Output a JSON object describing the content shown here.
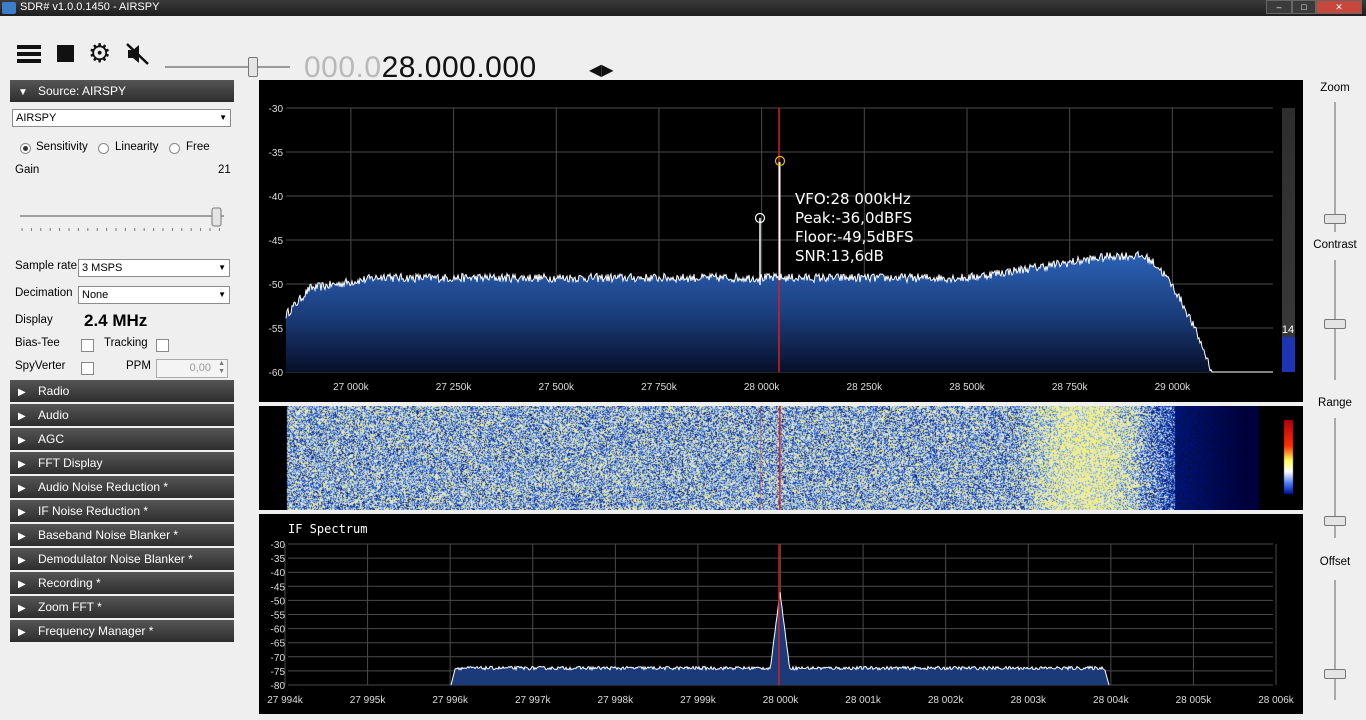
{
  "window": {
    "title": "SDR# v1.0.0.1450 - AIRSPY"
  },
  "toolbar": {
    "freq_dim": "000.0",
    "freq_main": "28.000.000"
  },
  "source": {
    "header": "Source: AIRSPY",
    "device": "AIRSPY",
    "modes": [
      "Sensitivity",
      "Linearity",
      "Free"
    ],
    "selected_mode": "Sensitivity",
    "gain_label": "Gain",
    "gain_value": "21",
    "sample_rate_label": "Sample rate",
    "sample_rate": "3 MSPS",
    "decimation_label": "Decimation",
    "decimation": "None",
    "display_label": "Display",
    "display_value": "2.4 MHz",
    "bias_tee_label": "Bias-Tee",
    "tracking_label": "Tracking",
    "spyverter_label": "SpyVerter",
    "ppm_label": "PPM",
    "ppm_value": "0,00"
  },
  "panels": [
    "Radio",
    "Audio",
    "AGC",
    "FFT Display",
    "Audio Noise Reduction *",
    "IF Noise Reduction *",
    "Baseband Noise Blanker *",
    "Demodulator Noise Blanker *",
    "Recording *",
    "Zoom FFT *",
    "Frequency Manager *"
  ],
  "spectrum": {
    "y_ticks": [
      "-30",
      "-35",
      "-40",
      "-45",
      "-50",
      "-55",
      "-60"
    ],
    "x_ticks": [
      "27 000k",
      "27 250k",
      "27 500k",
      "27 750k",
      "28 000k",
      "28 250k",
      "28 500k",
      "28 750k",
      "29 000k"
    ],
    "vfo": "VFO:28 000kHz",
    "peak": "Peak:-36,0dBFS",
    "floor": "Floor:-49,5dBFS",
    "snr": "SNR:13,6dB",
    "level_value": "14"
  },
  "if_spectrum": {
    "title": "IF Spectrum",
    "y_ticks": [
      "-30",
      "-35",
      "-40",
      "-45",
      "-50",
      "-55",
      "-60",
      "-65",
      "-70",
      "-75",
      "-80"
    ],
    "x_ticks": [
      "27 994k",
      "27 995k",
      "27 996k",
      "27 997k",
      "27 998k",
      "27 999k",
      "28 000k",
      "28 001k",
      "28 002k",
      "28 003k",
      "28 004k",
      "28 005k",
      "28 006k"
    ]
  },
  "right": {
    "zoom": "Zoom",
    "contrast": "Contrast",
    "range": "Range",
    "offset": "Offset"
  },
  "colors": {
    "vfo_line": "#d42020",
    "spectrum_fill": "#1f4d96",
    "panel_header": "#3a3a3a"
  }
}
